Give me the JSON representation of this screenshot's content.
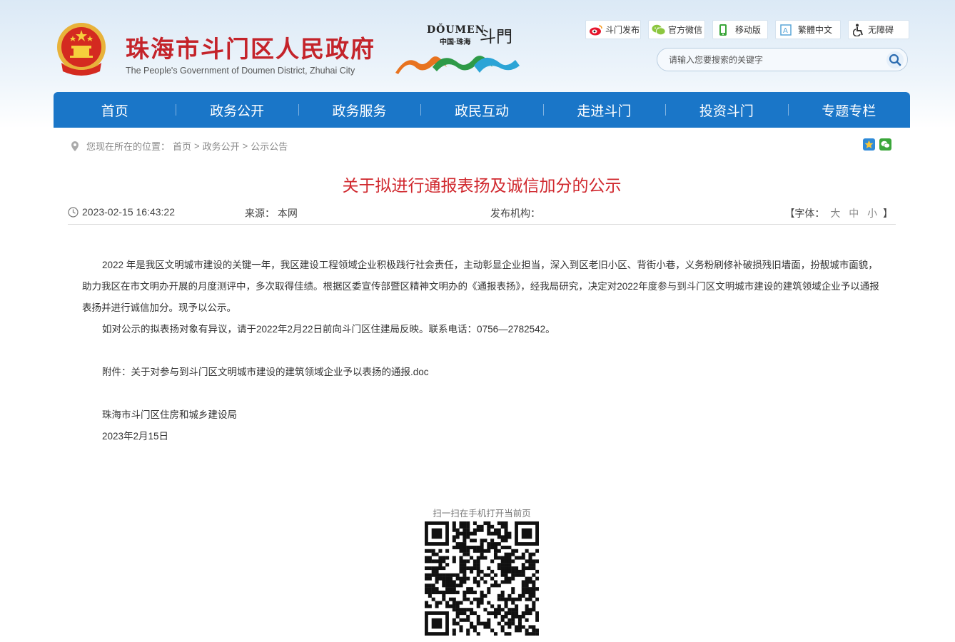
{
  "header": {
    "site_title": "珠海市斗门区人民政府",
    "site_subtitle": "The People's Government of Doumen District, Zhuhai City",
    "logo_en": "DŎUMEN",
    "logo_cn": "中国·珠海",
    "logo_char": "斗門",
    "toplinks": [
      {
        "label": "斗门发布",
        "icon": "weibo-icon"
      },
      {
        "label": "官方微信",
        "icon": "wechat-icon"
      },
      {
        "label": "移动版",
        "icon": "mobile-icon"
      },
      {
        "label": "繁體中文",
        "icon": "traditional-chinese-icon"
      },
      {
        "label": "无障碍",
        "icon": "accessibility-icon"
      }
    ],
    "search_placeholder": "请输入您要搜索的关键字"
  },
  "nav": [
    "首页",
    "政务公开",
    "政务服务",
    "政民互动",
    "走进斗门",
    "投资斗门",
    "专题专栏"
  ],
  "breadcrumb": {
    "prefix": "您现在所在的位置：",
    "items": [
      "首页",
      "政务公开",
      "公示公告"
    ],
    "sep": ">"
  },
  "article": {
    "title": "关于拟进行通报表扬及诚信加分的公示",
    "date": "2023-02-15 16:43:22",
    "source_label": "来源：",
    "source": "本网",
    "publisher_label": "发布机构：",
    "publisher": "",
    "font_label": "【字体：",
    "font_sizes": [
      "大",
      "中",
      "小"
    ],
    "font_end": "】",
    "paragraphs": [
      "2022 年是我区文明城市建设的关键一年，我区建设工程领域企业积极践行社会责任，主动彰显企业担当，深入到区老旧小区、背街小巷，义务粉刷修补破损残旧墙面，扮靓城市面貌，助力我区在市文明办开展的月度测评中，多次取得佳绩。根据区委宣传部暨区精神文明办的《通报表扬》，经我局研究，决定对2022年度参与到斗门区文明城市建设的建筑领域企业予以通报表扬并进行诚信加分。现予以公示。",
      "如对公示的拟表扬对象有异议，请于2022年2月22日前向斗门区住建局反映。联系电话：0756—2782542。"
    ],
    "attachment": "附件：关于对参与到斗门区文明城市建设的建筑领域企业予以表扬的通报.doc",
    "signature": "珠海市斗门区住房和城乡建设局",
    "sign_date": "2023年2月15日"
  },
  "qr_label": "扫一扫在手机打开当前页",
  "colors": {
    "nav_bg": "#1a76c8",
    "title_red": "#d0282e",
    "site_title_red": "#c4232a"
  }
}
